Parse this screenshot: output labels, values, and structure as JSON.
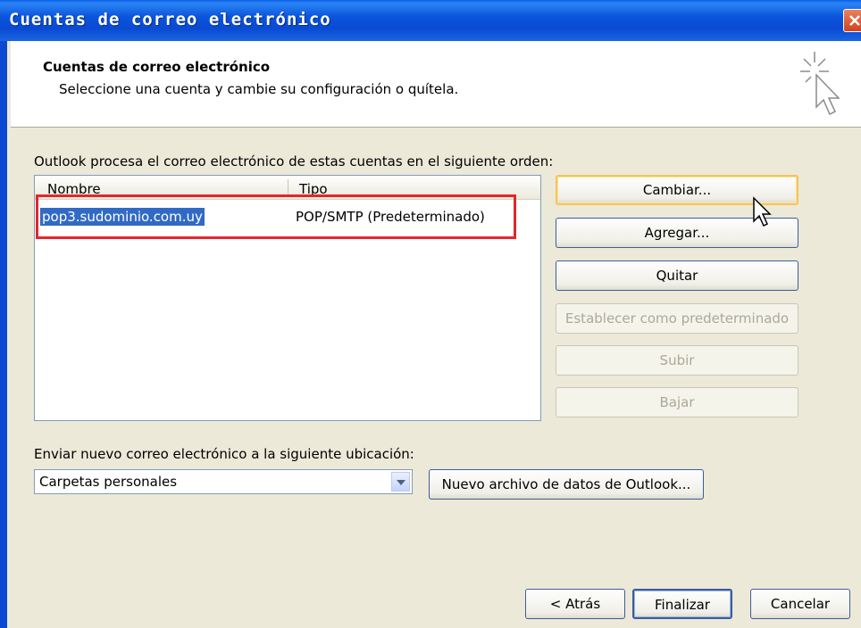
{
  "window": {
    "title": "Cuentas de correo electrónico"
  },
  "header": {
    "title": "Cuentas de correo electrónico",
    "subtitle": "Seleccione una cuenta y cambie su configuración o quítela."
  },
  "accounts": {
    "description": "Outlook procesa el correo electrónico de estas cuentas en el siguiente orden:",
    "columns": [
      "Nombre",
      "Tipo"
    ],
    "rows": [
      {
        "name": "pop3.sudominio.com.uy",
        "type": "POP/SMTP (Predeterminado)"
      }
    ]
  },
  "actions": {
    "change": "Cambiar...",
    "add": "Agregar...",
    "remove": "Quitar",
    "set_default": "Establecer como predeterminado",
    "move_up": "Subir",
    "move_down": "Bajar"
  },
  "delivery": {
    "label": "Enviar nuevo correo electrónico a la siguiente ubicación:",
    "selected": "Carpetas personales",
    "new_data_file": "Nuevo archivo de datos de Outlook..."
  },
  "footer": {
    "back": "< Atrás",
    "finish": "Finalizar",
    "cancel": "Cancelar"
  },
  "colors": {
    "highlight_box": "#e3262e",
    "selection": "#316ac5",
    "titlebar": "#0a4ad2"
  }
}
